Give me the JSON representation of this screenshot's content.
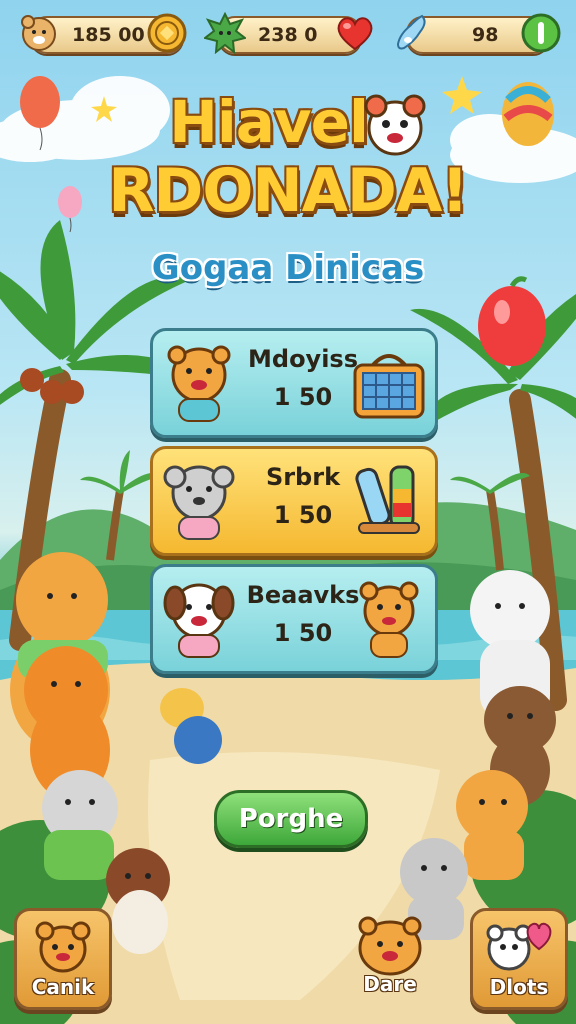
{
  "top_bar": {
    "resource_1": {
      "value": "185 00",
      "icon": "hamster-icon",
      "action_icon": "coin-icon"
    },
    "resource_2": {
      "value": "238 0",
      "icon": "leaf-creature-icon",
      "action_icon": "heart-icon"
    },
    "resource_3": {
      "value": "98",
      "icon": "potion-drop-icon",
      "action_icon": "add-button-icon"
    }
  },
  "header": {
    "title_line_1": "Hiavelo",
    "title_line_2": "RDONADA!",
    "subtitle": "Gogaa Dinicas"
  },
  "offers": [
    {
      "name": "Mdoyiss",
      "price": "1 50",
      "left_icon": "tiger-cub-icon",
      "right_icon": "tile-box-icon",
      "style": "teal"
    },
    {
      "name": "Srbrk",
      "price": "1 50",
      "left_icon": "koala-icon",
      "right_icon": "color-tubes-icon",
      "style": "gold"
    },
    {
      "name": "Beaavks",
      "price": "1 50",
      "left_icon": "puppy-icon",
      "right_icon": "tiger-cub-icon",
      "style": "teal"
    }
  ],
  "main_button": {
    "label": "Porghe"
  },
  "bottom_nav": [
    {
      "label": "Canik",
      "icon": "hamster-icon"
    },
    {
      "label": "Dare",
      "icon": "tiger-cub-icon"
    },
    {
      "label": "Dlots",
      "icon": "bear-heart-icon"
    }
  ],
  "colors": {
    "sky": "#8fd3ee",
    "sand": "#ecd6a2",
    "title_fill": "#ffcc33",
    "subtitle_fill": "#2a8fc4",
    "button_green": "#3ea83a",
    "card_teal": "#79d2d9",
    "card_gold": "#f5b830"
  }
}
